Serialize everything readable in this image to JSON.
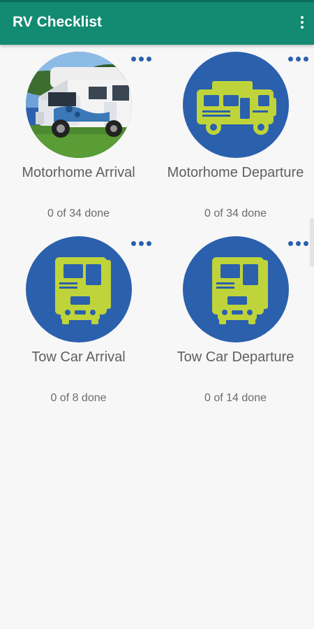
{
  "app": {
    "title": "RV Checklist"
  },
  "colors": {
    "appbar": "#138a72",
    "accent": "#2b60ad",
    "icon_green": "#bfd43a"
  },
  "menu_icon": "overflow-vertical-icon",
  "cards": [
    {
      "name": "Motorhome Arrival",
      "status": "0 of 34 done",
      "image": "motorhome-photo"
    },
    {
      "name": "Motorhome Departure",
      "status": "0 of 34 done",
      "image": "motorhome-icon"
    },
    {
      "name": "Tow Car Arrival",
      "status": "0 of 8 done",
      "image": "tow-car-icon"
    },
    {
      "name": "Tow Car Departure",
      "status": "0 of 14 done",
      "image": "tow-car-icon"
    }
  ]
}
